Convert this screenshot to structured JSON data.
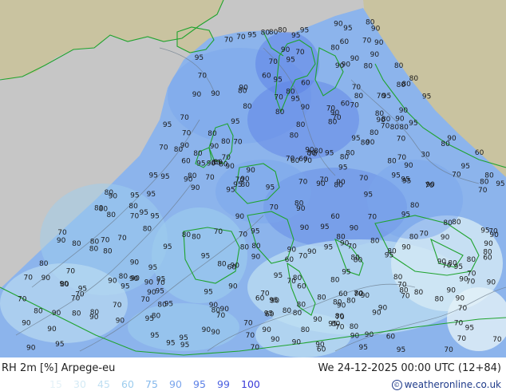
{
  "map": {
    "title": "RH 2m [%] Arpege-eu",
    "datetime": "We 24-12-2025 00:00 UTC (12+84)",
    "credit": "weatheronline.co.uk",
    "scale": {
      "values": [
        "15",
        "30",
        "45",
        "60",
        "75",
        "90",
        "95",
        "99",
        "100"
      ],
      "colors": [
        "#e4f1f8",
        "#d4eaf5",
        "#bfdff2",
        "#9dcdee",
        "#84b8ec",
        "#7aa5ec",
        "#5b7fe6",
        "#4a5fe0",
        "#3a3ad8"
      ]
    },
    "colors": {
      "background": "#c6c6c6",
      "land": "#c9c3a0",
      "ocean": "#8cb4ec",
      "coast": "#1fa32e"
    },
    "labels": [
      "80",
      "60",
      "90",
      "80",
      "70",
      "80",
      "80",
      "95",
      "90",
      "80",
      "90",
      "70",
      "80",
      "80",
      "90",
      "80",
      "70",
      "90",
      "95",
      "95",
      "90",
      "70",
      "80",
      "70",
      "80",
      "90",
      "90",
      "90",
      "95",
      "90",
      "90",
      "95",
      "70",
      "70",
      "80",
      "80",
      "95",
      "90",
      "90",
      "95",
      "80",
      "90",
      "90",
      "90",
      "90",
      "80",
      "95",
      "90",
      "80",
      "95",
      "80",
      "95",
      "95",
      "90",
      "95",
      "90",
      "80",
      "95",
      "95",
      "90",
      "80",
      "70",
      "80",
      "90",
      "80",
      "90",
      "95",
      "95",
      "90",
      "95",
      "90",
      "90",
      "95",
      "95",
      "95",
      "70",
      "70",
      "90",
      "80",
      "80",
      "80",
      "95",
      "70",
      "90",
      "90",
      "90",
      "95",
      "95",
      "95",
      "80",
      "95",
      "90",
      "90",
      "95",
      "90",
      "90",
      "95",
      "90",
      "90",
      "95",
      "80",
      "70",
      "80",
      "95",
      "80",
      "90",
      "90",
      "95",
      "95",
      "90",
      "95",
      "80",
      "80",
      "90",
      "70",
      "70",
      "70",
      "90",
      "80",
      "95",
      "80",
      "90",
      "95",
      "95",
      "90",
      "90",
      "90",
      "90",
      "70",
      "80",
      "70",
      "70",
      "95",
      "90",
      "80",
      "90",
      "70",
      "70",
      "90",
      "70",
      "90",
      "80",
      "70",
      "80",
      "80",
      "80",
      "80",
      "70",
      "80",
      "90",
      "80",
      "90",
      "95",
      "80",
      "90",
      "70",
      "80",
      "80",
      "90",
      "90",
      "95",
      "95",
      "95",
      "80",
      "95",
      "80",
      "70",
      "70",
      "95",
      "70",
      "70",
      "90",
      "70",
      "80",
      "80",
      "70",
      "90",
      "90",
      "70",
      "80",
      "90",
      "95",
      "95",
      "80",
      "70",
      "95",
      "70",
      "95",
      "80",
      "80",
      "90",
      "90",
      "70",
      "60",
      "90",
      "80",
      "95",
      "95",
      "80",
      "70",
      "80",
      "95",
      "90",
      "80",
      "70",
      "80",
      "70",
      "95",
      "80",
      "90",
      "70",
      "80",
      "90",
      "80",
      "80",
      "60",
      "70",
      "80",
      "60",
      "90",
      "70",
      "90",
      "80",
      "70",
      "70",
      "80",
      "90",
      "70",
      "95",
      "80",
      "90",
      "80",
      "70",
      "80",
      "60",
      "70",
      "95",
      "80",
      "70",
      "90",
      "90",
      "95",
      "70",
      "80",
      "90",
      "80",
      "70",
      "70",
      "80",
      "80",
      "60",
      "70",
      "95",
      "90",
      "80",
      "90",
      "80",
      "90",
      "70",
      "70",
      "60",
      "70",
      "90",
      "90",
      "60",
      "95",
      "95",
      "70",
      "80",
      "70",
      "70",
      "95",
      "80",
      "80",
      "95",
      "70",
      "70",
      "95",
      "80",
      "70",
      "90",
      "80",
      "60",
      "80",
      "80",
      "90",
      "60",
      "80",
      "60",
      "80",
      "90",
      "80",
      "70",
      "80",
      "80",
      "80",
      "70",
      "60",
      "80",
      "90",
      "80",
      "90",
      "70",
      "30",
      "60",
      "80",
      "70",
      "70",
      "80",
      "95",
      "80",
      "80",
      "70",
      "95",
      "70",
      "60",
      "70",
      "70",
      "60",
      "95",
      "60",
      "60",
      "70",
      "70",
      "80",
      "80",
      "80",
      "80",
      "60"
    ]
  }
}
